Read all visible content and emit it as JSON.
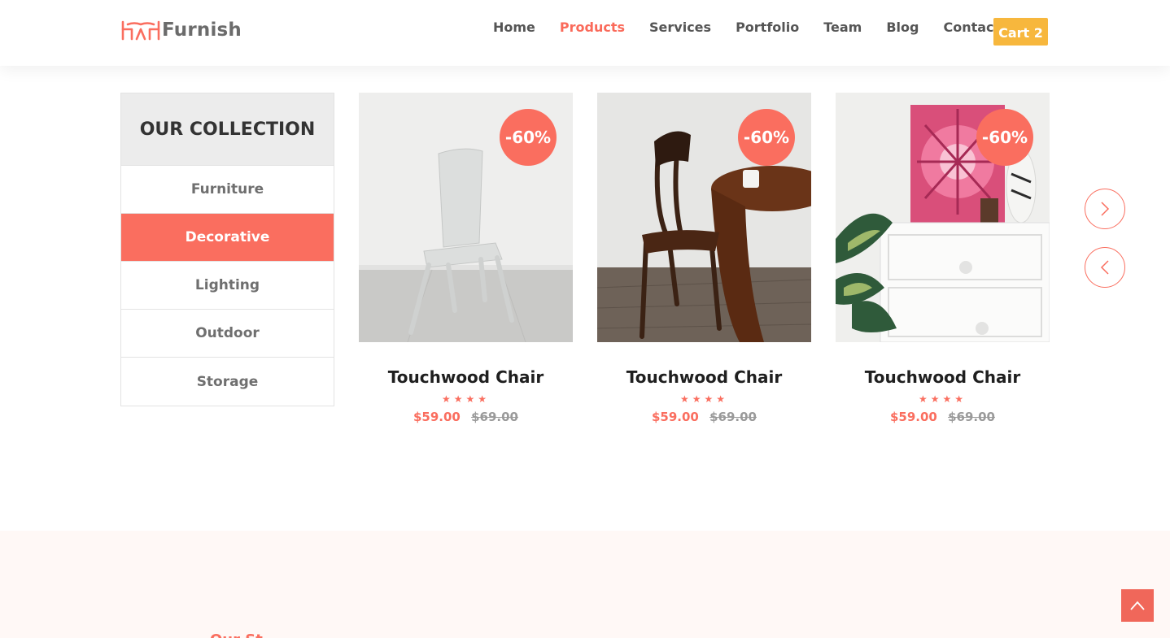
{
  "brand": {
    "name": "Furnish",
    "logo_icon": "furniture-logo-icon",
    "accent": "#fa6e5f"
  },
  "nav": {
    "items": [
      "Home",
      "Products",
      "Services",
      "Portfolio",
      "Team",
      "Blog",
      "Contact"
    ],
    "active": "Products"
  },
  "cart": {
    "label": "Cart",
    "count": "2",
    "color": "#f7b73d"
  },
  "collection": {
    "title": "OUR COLLECTION",
    "categories": [
      "Furniture",
      "Decorative",
      "Lighting",
      "Outdoor",
      "Storage"
    ],
    "active": "Decorative"
  },
  "products": [
    {
      "name": "Touchwood Chair",
      "discount": "-60%",
      "price": "$59.00",
      "old_price": "$69.00",
      "rating": 4,
      "image": "white-chair-photo"
    },
    {
      "name": "Touchwood Chair",
      "discount": "-60%",
      "price": "$59.00",
      "old_price": "$69.00",
      "rating": 4,
      "image": "wooden-chair-table-photo"
    },
    {
      "name": "Touchwood Chair",
      "discount": "-60%",
      "price": "$59.00",
      "old_price": "$69.00",
      "rating": 4,
      "image": "dresser-flower-painting-photo"
    }
  ],
  "slider": {
    "next_icon": "chevron-right-icon",
    "prev_icon": "chevron-left-icon"
  },
  "bottom_section": {
    "partial_heading": "Our St"
  },
  "scroll_top": {
    "icon": "chevron-up-icon"
  }
}
